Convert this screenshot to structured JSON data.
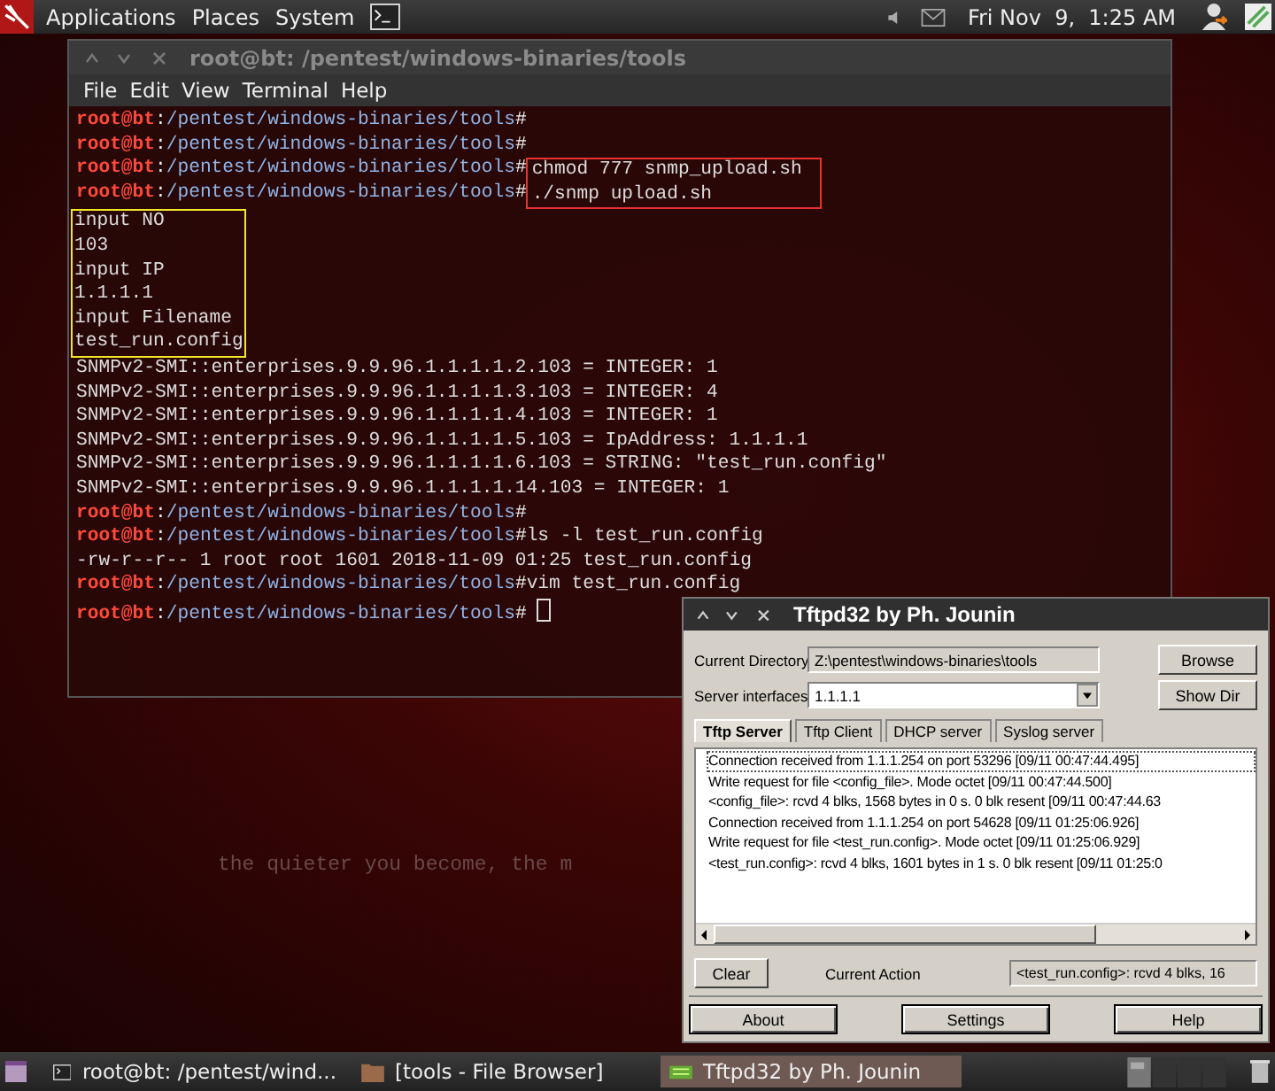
{
  "top_panel": {
    "menus": [
      "Applications",
      "Places",
      "System"
    ],
    "clock": "Fri Nov  9,  1:25 AM"
  },
  "wallpaper": {
    "tagline": "the quieter you become, the m"
  },
  "terminal": {
    "title": "root@bt: /pentest/windows-binaries/tools",
    "menu": [
      "File",
      "Edit",
      "View",
      "Terminal",
      "Help"
    ],
    "blocks": [
      {
        "lines": [
          {
            "kind": "prompt",
            "user": "root@bt",
            "separator": ":",
            "path": "/pentest/windows-binaries/tools",
            "hash": "#"
          },
          {
            "kind": "prompt",
            "user": "root@bt",
            "separator": ":",
            "path": "/pentest/windows-binaries/tools",
            "hash": "#"
          }
        ]
      },
      {
        "color": "#e8322e",
        "lines": [
          {
            "kind": "prompt",
            "user": "root@bt",
            "separator": ":",
            "path": "/pentest/windows-binaries/tools",
            "hash": "#",
            "command": "chmod 777 snmp_upload.sh"
          },
          {
            "kind": "prompt",
            "user": "root@bt",
            "separator": ":",
            "path": "/pentest/windows-binaries/tools",
            "hash": "#",
            "command": "./snmp upload.sh"
          }
        ]
      },
      {
        "color": "#f2e52a",
        "lines": [
          {
            "kind": "output",
            "text": "input NO"
          },
          {
            "kind": "output",
            "text": "103"
          },
          {
            "kind": "output",
            "text": "input IP"
          },
          {
            "kind": "output",
            "text": "1.1.1.1"
          },
          {
            "kind": "output",
            "text": "input Filename"
          },
          {
            "kind": "output",
            "text": "test_run.config"
          }
        ]
      },
      {
        "lines": [
          {
            "kind": "output",
            "text": "SNMPv2-SMI::enterprises.9.9.96.1.1.1.1.2.103 = INTEGER: 1"
          },
          {
            "kind": "output",
            "text": "SNMPv2-SMI::enterprises.9.9.96.1.1.1.1.3.103 = INTEGER: 4"
          },
          {
            "kind": "output",
            "text": "SNMPv2-SMI::enterprises.9.9.96.1.1.1.1.4.103 = INTEGER: 1"
          },
          {
            "kind": "output",
            "text": "SNMPv2-SMI::enterprises.9.9.96.1.1.1.1.5.103 = IpAddress: 1.1.1.1"
          },
          {
            "kind": "output",
            "text": "SNMPv2-SMI::enterprises.9.9.96.1.1.1.1.6.103 = STRING: \"test_run.config\""
          },
          {
            "kind": "output",
            "text": "SNMPv2-SMI::enterprises.9.9.96.1.1.1.1.14.103 = INTEGER: 1"
          },
          {
            "kind": "prompt",
            "user": "root@bt",
            "separator": ":",
            "path": "/pentest/windows-binaries/tools",
            "hash": "#"
          },
          {
            "kind": "prompt",
            "user": "root@bt",
            "separator": ":",
            "path": "/pentest/windows-binaries/tools",
            "hash": "#",
            "command": "ls -l test_run.config"
          },
          {
            "kind": "output",
            "text": "-rw-r--r-- 1 root root 1601 2018-11-09 01:25 test_run.config"
          },
          {
            "kind": "prompt",
            "user": "root@bt",
            "separator": ":",
            "path": "/pentest/windows-binaries/tools",
            "hash": "#",
            "command": "vim test_run.config"
          },
          {
            "kind": "prompt",
            "user": "root@bt",
            "separator": ":",
            "path": "/pentest/windows-binaries/tools",
            "hash": "#",
            "cursor": true
          }
        ]
      }
    ]
  },
  "tftpd": {
    "title": "Tftpd32 by Ph. Jounin",
    "current_directory": {
      "label": "Current Directory",
      "value": "Z:\\pentest\\windows-binaries\\tools"
    },
    "server_interfaces": {
      "label": "Server interfaces",
      "value": "1.1.1.1"
    },
    "side_buttons": [
      "Browse",
      "Show Dir"
    ],
    "tabs": [
      {
        "label": "Tftp Server",
        "selected": true
      },
      {
        "label": "Tftp Client",
        "selected": false
      },
      {
        "label": "DHCP server",
        "selected": false
      },
      {
        "label": "Syslog server",
        "selected": false
      }
    ],
    "log": [
      {
        "text": "Connection received from 1.1.1.254 on port 53296 [09/11 00:47:44.495]",
        "selected": true
      },
      {
        "text": "Write request for file <config_file>. Mode octet [09/11 00:47:44.500]",
        "selected": false
      },
      {
        "text": "<config_file>: rcvd 4 blks, 1568 bytes in 0 s. 0 blk resent [09/11 00:47:44.63",
        "selected": false
      },
      {
        "text": "Connection received from 1.1.1.254 on port 54628 [09/11 01:25:06.926]",
        "selected": false
      },
      {
        "text": "Write request for file <test_run.config>. Mode octet [09/11 01:25:06.929]",
        "selected": false
      },
      {
        "text": "<test_run.config>: rcvd 4 blks, 1601 bytes in 1 s. 0 blk resent [09/11 01:25:0",
        "selected": false
      }
    ],
    "clear_button": "Clear",
    "current_action": {
      "label": "Current Action",
      "value": "<test_run.config>: rcvd 4 blks, 16"
    },
    "bottom_buttons": [
      "About",
      "Settings",
      "Help"
    ]
  },
  "taskbar": [
    {
      "kind": "terminal",
      "label": "root@bt: /pentest/wind...",
      "selected": false
    },
    {
      "kind": "folder",
      "label": "[tools - File Browser]",
      "selected": false
    },
    {
      "kind": "tftpd",
      "label": "Tftpd32 by Ph. Jounin",
      "selected": true
    }
  ]
}
